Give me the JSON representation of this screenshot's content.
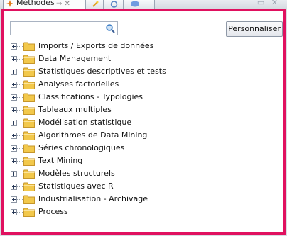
{
  "panel": {
    "tab_title": "Méthodes",
    "tab_extra": "⇒ ✕",
    "window_controls": "▭ ✕"
  },
  "search": {
    "value": "",
    "placeholder": ""
  },
  "toolbar": {
    "customize_label": "Personnaliser"
  },
  "tree": {
    "items": [
      {
        "label": "Imports / Exports de données"
      },
      {
        "label": "Data Management"
      },
      {
        "label": "Statistiques descriptives et tests"
      },
      {
        "label": "Analyses factorielles"
      },
      {
        "label": "Classifications - Typologies"
      },
      {
        "label": "Tableaux multiples"
      },
      {
        "label": "Modélisation statistique"
      },
      {
        "label": "Algorithmes de Data Mining"
      },
      {
        "label": "Séries chronologiques"
      },
      {
        "label": "Text Mining"
      },
      {
        "label": "Modèles structurels"
      },
      {
        "label": "Statistiques avec R"
      },
      {
        "label": "Industrialisation - Archivage"
      },
      {
        "label": "Process"
      }
    ]
  },
  "colors": {
    "highlight_frame": "#e0115f",
    "folder": "#f2c84b"
  },
  "icons": [
    "methods-icon",
    "search-icon",
    "folder-icon",
    "expand-icon"
  ]
}
